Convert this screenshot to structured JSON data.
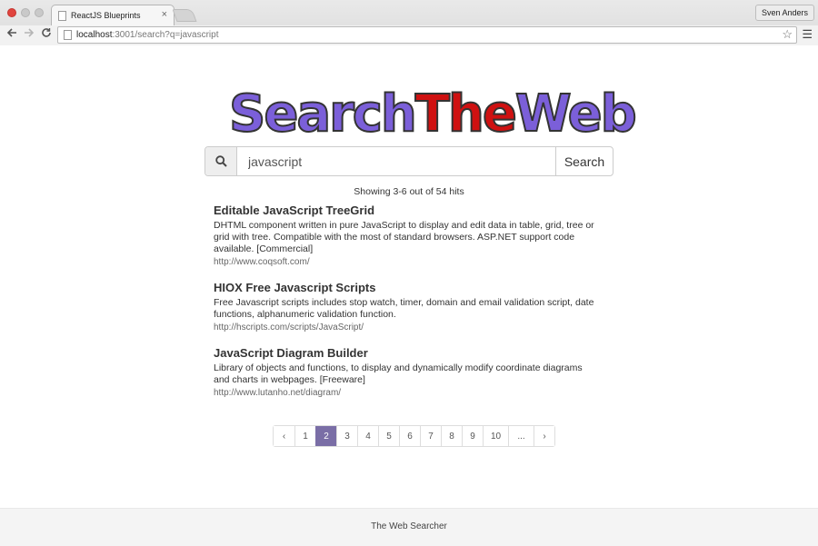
{
  "browser": {
    "tab_title": "ReactJS Blueprints",
    "tab_close": "×",
    "profile_name": "Sven Anders",
    "url_host": "localhost",
    "url_rest": ":3001/search?q=javascript",
    "icons": {
      "back": "arrow-left",
      "forward": "arrow-right",
      "reload": "reload",
      "star": "star",
      "menu": "hamburger"
    }
  },
  "logo": {
    "part1": "Search",
    "part2": "The",
    "part3": "Web",
    "colors": {
      "primary": "#7b5fd9",
      "accent": "#cf1111"
    }
  },
  "search": {
    "query": "javascript",
    "button_label": "Search"
  },
  "hits_text": "Showing 3-6 out of 54 hits",
  "results": [
    {
      "title": "Editable JavaScript TreeGrid",
      "description": "DHTML component written in pure JavaScript to display and edit data in table, grid, tree or grid with tree. Compatible with the most of standard browsers. ASP.NET support code available. [Commercial]",
      "url": "http://www.coqsoft.com/"
    },
    {
      "title": "HIOX Free Javascript Scripts",
      "description": "Free Javascript scripts includes stop watch, timer, domain and email validation script, date functions, alphanumeric validation function.",
      "url": "http://hscripts.com/scripts/JavaScript/"
    },
    {
      "title": "JavaScript Diagram Builder",
      "description": "Library of objects and functions, to display and dynamically modify coordinate diagrams and charts in webpages. [Freeware]",
      "url": "http://www.lutanho.net/diagram/"
    }
  ],
  "pagination": {
    "prev": "‹",
    "next": "›",
    "pages": [
      "1",
      "2",
      "3",
      "4",
      "5",
      "6",
      "7",
      "8",
      "9",
      "10",
      "..."
    ],
    "active": "2",
    "active_color": "#7a6ea6"
  },
  "footer_text": "The Web Searcher"
}
